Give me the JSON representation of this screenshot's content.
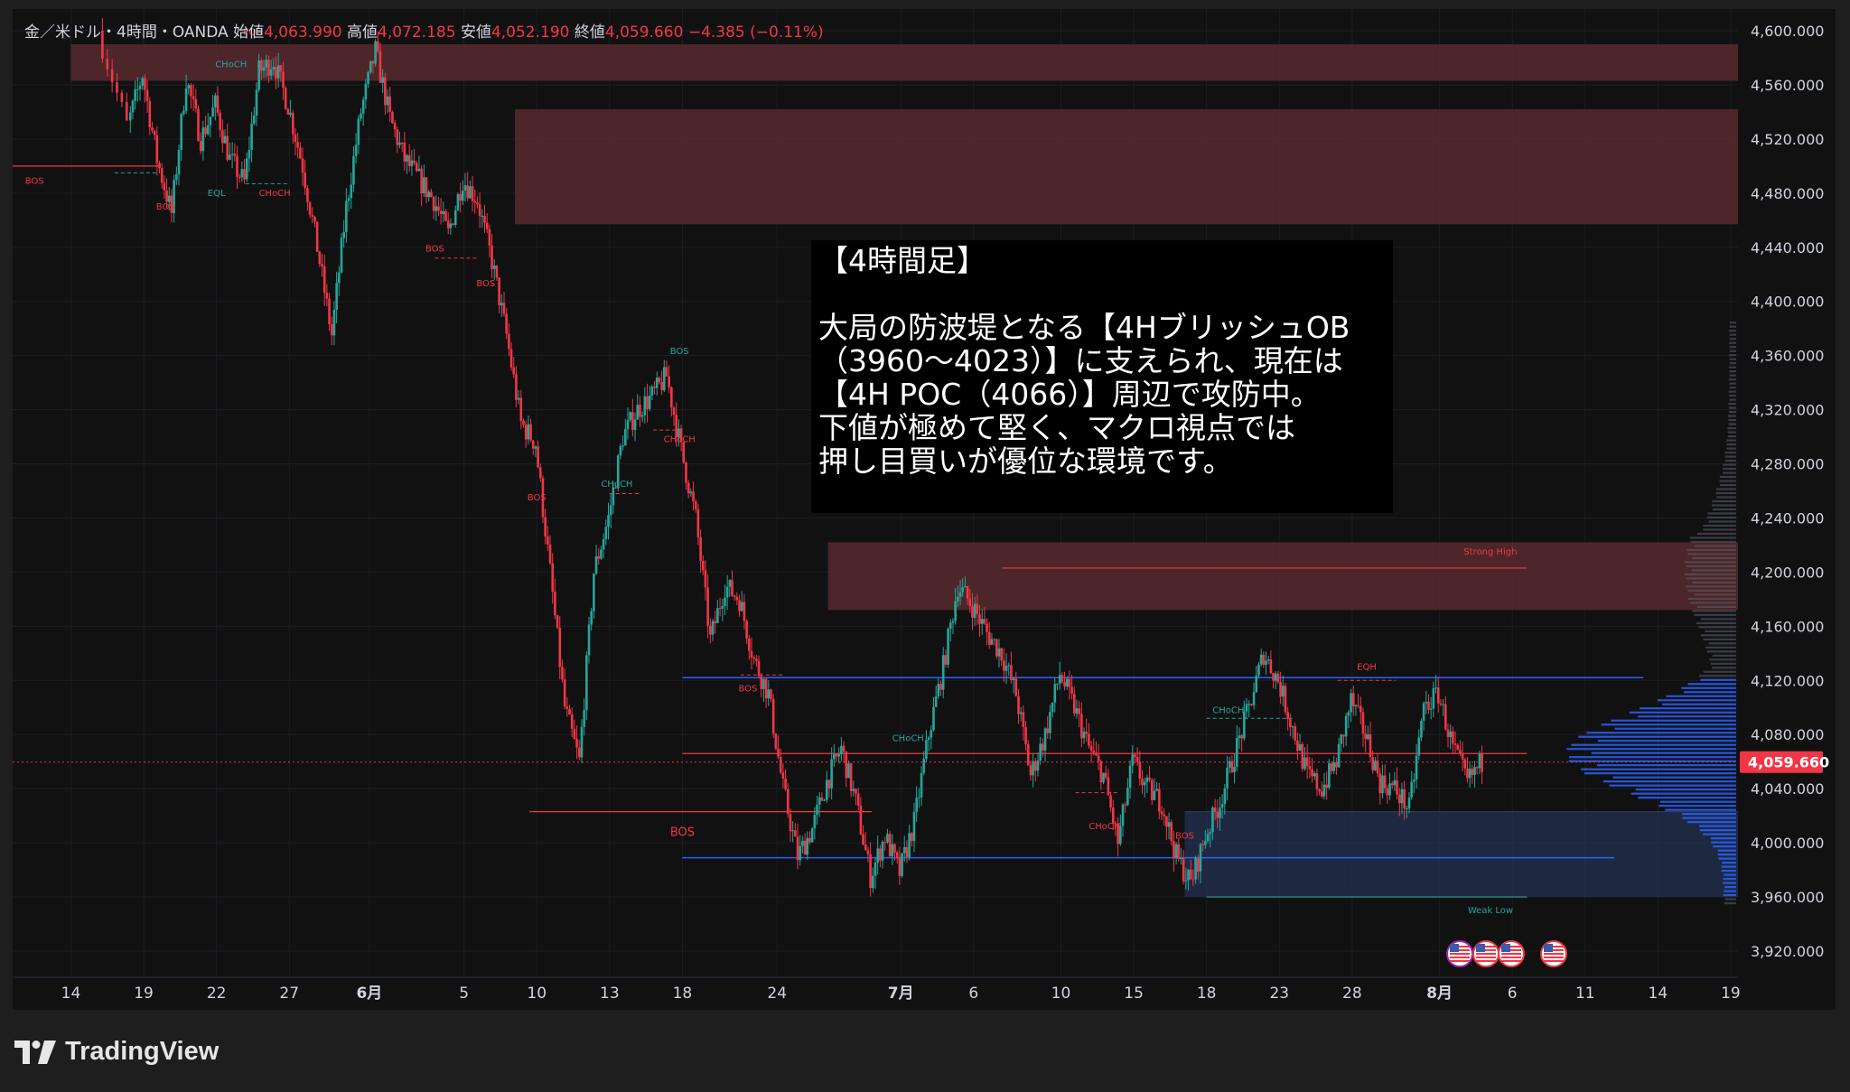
{
  "header": {
    "symbol": "金／米ドル・4時間・OANDA",
    "open_label": "始値",
    "open": "4,063.990",
    "high_label": "高値",
    "high": "4,072.185",
    "low_label": "安値",
    "low": "4,052.190",
    "close_label": "終値",
    "close": "4,059.660",
    "change": "−4.385 (−0.11%)"
  },
  "annotation": {
    "title": "【4時間足】",
    "lines": [
      "大局の防波堤となる【4HブリッシュOB",
      "（3960〜4023）】に支えられ、現在は",
      "【4H POC（4066）】周辺で攻防中。",
      "下値が極めて堅く、マクロ視点では",
      "押し目買いが優位な環境です。"
    ]
  },
  "brand": {
    "name": "TradingView",
    "icon": "tradingview-logo-icon"
  },
  "colors": {
    "up": "#26a69a",
    "down": "#f23645",
    "supply_zone": "#5b2c2f",
    "demand_zone": "#22304d",
    "volume_profile": "#2962ff",
    "blue_line": "#2962ff",
    "price_badge": "#f23645"
  },
  "chart_data": {
    "type": "candlestick",
    "symbol": "XAU/USD",
    "timeframe": "4H",
    "ylim": [
      3900,
      4610
    ],
    "y_ticks": [
      "4,600.000",
      "4,560.000",
      "4,520.000",
      "4,480.000",
      "4,440.000",
      "4,400.000",
      "4,360.000",
      "4,320.000",
      "4,280.000",
      "4,240.000",
      "4,200.000",
      "4,160.000",
      "4,120.000",
      "4,080.000",
      "4,040.000",
      "4,000.000",
      "3,960.000",
      "3,920.000"
    ],
    "current_price": 4059.66,
    "current_price_label": "4,059.660",
    "x_labels": [
      {
        "label": "14",
        "day": -4
      },
      {
        "label": "19",
        "day": 1
      },
      {
        "label": "22",
        "day": 6
      },
      {
        "label": "27",
        "day": 11
      },
      {
        "label": "6月",
        "day": 16.5
      },
      {
        "label": "5",
        "day": 23
      },
      {
        "label": "10",
        "day": 28
      },
      {
        "label": "13",
        "day": 33
      },
      {
        "label": "18",
        "day": 38
      },
      {
        "label": "24",
        "day": 44.5
      },
      {
        "label": "7月",
        "day": 53
      },
      {
        "label": "6",
        "day": 58
      },
      {
        "label": "10",
        "day": 64
      },
      {
        "label": "15",
        "day": 69
      },
      {
        "label": "18",
        "day": 74
      },
      {
        "label": "23",
        "day": 79
      },
      {
        "label": "28",
        "day": 84
      },
      {
        "label": "8月",
        "day": 90
      },
      {
        "label": "6",
        "day": 95
      },
      {
        "label": "11",
        "day": 100
      },
      {
        "label": "14",
        "day": 105
      },
      {
        "label": "19",
        "day": 110
      }
    ],
    "x_range_days": [
      -8,
      110.5
    ],
    "path": [
      [
        -2,
        4600
      ],
      [
        0,
        4530
      ],
      [
        1,
        4568
      ],
      [
        2,
        4505
      ],
      [
        3,
        4465
      ],
      [
        4,
        4565
      ],
      [
        5,
        4520
      ],
      [
        6,
        4545
      ],
      [
        7,
        4505
      ],
      [
        8,
        4488
      ],
      [
        9,
        4570
      ],
      [
        10,
        4578
      ],
      [
        11,
        4545
      ],
      [
        12,
        4500
      ],
      [
        13,
        4440
      ],
      [
        14,
        4375
      ],
      [
        15,
        4470
      ],
      [
        16,
        4540
      ],
      [
        17,
        4585
      ],
      [
        18,
        4535
      ],
      [
        19,
        4505
      ],
      [
        20,
        4490
      ],
      [
        21,
        4475
      ],
      [
        22,
        4450
      ],
      [
        23,
        4490
      ],
      [
        24,
        4475
      ],
      [
        25,
        4430
      ],
      [
        26,
        4375
      ],
      [
        27,
        4310
      ],
      [
        28,
        4295
      ],
      [
        29,
        4200
      ],
      [
        30,
        4100
      ],
      [
        31,
        4060
      ],
      [
        32,
        4200
      ],
      [
        33,
        4240
      ],
      [
        34,
        4300
      ],
      [
        35,
        4320
      ],
      [
        36,
        4330
      ],
      [
        37,
        4345
      ],
      [
        38,
        4290
      ],
      [
        39,
        4240
      ],
      [
        40,
        4150
      ],
      [
        41,
        4190
      ],
      [
        42,
        4180
      ],
      [
        43,
        4135
      ],
      [
        44,
        4110
      ],
      [
        45,
        4040
      ],
      [
        46,
        3990
      ],
      [
        47,
        4010
      ],
      [
        48,
        4045
      ],
      [
        49,
        4070
      ],
      [
        50,
        4030
      ],
      [
        51,
        3975
      ],
      [
        52,
        4005
      ],
      [
        53,
        3978
      ],
      [
        54,
        4015
      ],
      [
        55,
        4080
      ],
      [
        56,
        4130
      ],
      [
        57,
        4190
      ],
      [
        58,
        4175
      ],
      [
        59,
        4155
      ],
      [
        60,
        4140
      ],
      [
        61,
        4110
      ],
      [
        62,
        4050
      ],
      [
        63,
        4080
      ],
      [
        64,
        4125
      ],
      [
        65,
        4100
      ],
      [
        66,
        4070
      ],
      [
        67,
        4050
      ],
      [
        68,
        4000
      ],
      [
        69,
        4060
      ],
      [
        70,
        4040
      ],
      [
        71,
        4030
      ],
      [
        72,
        3990
      ],
      [
        73,
        3970
      ],
      [
        74,
        4005
      ],
      [
        75,
        4030
      ],
      [
        76,
        4065
      ],
      [
        77,
        4100
      ],
      [
        78,
        4140
      ],
      [
        79,
        4120
      ],
      [
        80,
        4085
      ],
      [
        81,
        4050
      ],
      [
        82,
        4040
      ],
      [
        83,
        4060
      ],
      [
        84,
        4105
      ],
      [
        85,
        4080
      ],
      [
        86,
        4045
      ],
      [
        87,
        4040
      ],
      [
        88,
        4025
      ],
      [
        89,
        4100
      ],
      [
        90,
        4110
      ],
      [
        91,
        4070
      ],
      [
        92,
        4045
      ],
      [
        93,
        4060
      ]
    ],
    "zones": [
      {
        "kind": "supply",
        "y1": 4563,
        "y2": 4590,
        "d1": -4,
        "d2": 110.5
      },
      {
        "kind": "supply",
        "y1": 4457,
        "y2": 4542,
        "d1": 26.5,
        "d2": 110.5
      },
      {
        "kind": "supply",
        "y1": 4172,
        "y2": 4222,
        "d1": 48,
        "d2": 110.5
      },
      {
        "kind": "demand",
        "y1": 3960,
        "y2": 4023,
        "d1": 72.5,
        "d2": 110.5
      }
    ],
    "levels": [
      {
        "kind": "blue",
        "y": 4122,
        "d1": 38,
        "d2": 104
      },
      {
        "kind": "blue",
        "y": 3989,
        "d1": 38,
        "d2": 102
      },
      {
        "kind": "red",
        "y": 4066,
        "d1": 38,
        "d2": 96
      },
      {
        "kind": "red",
        "y": 4203,
        "d1": 60,
        "d2": 96
      },
      {
        "kind": "red",
        "y": 4500,
        "d1": -8,
        "d2": 2
      },
      {
        "kind": "red",
        "y": 4023,
        "d1": 27.5,
        "d2": 51
      },
      {
        "kind": "teal",
        "y": 3960,
        "d1": 74,
        "d2": 96
      }
    ],
    "labels": [
      {
        "text": "BOS",
        "d": -6.5,
        "y": 4487,
        "color": "red"
      },
      {
        "text": "BOS",
        "d": 2.5,
        "y": 4468,
        "color": "red"
      },
      {
        "text": "CHoCH",
        "d": 7,
        "y": 4573,
        "color": "teal"
      },
      {
        "text": "EQH",
        "d": 8.5,
        "y": 4597,
        "color": "red"
      },
      {
        "text": "EQL",
        "d": 6,
        "y": 4478,
        "color": "teal"
      },
      {
        "text": "CHoCH",
        "d": 10,
        "y": 4478,
        "color": "red"
      },
      {
        "text": "BOS",
        "d": 21,
        "y": 4437,
        "color": "red"
      },
      {
        "text": "BOS",
        "d": 24.5,
        "y": 4411,
        "color": "red"
      },
      {
        "text": "BOS",
        "d": 28,
        "y": 4253,
        "color": "red"
      },
      {
        "text": "CHoCH",
        "d": 33.5,
        "y": 4263,
        "color": "teal"
      },
      {
        "text": "BOS",
        "d": 37.8,
        "y": 4361,
        "color": "teal"
      },
      {
        "text": "CHoCH",
        "d": 37.8,
        "y": 4296,
        "color": "red"
      },
      {
        "text": "BOS",
        "d": 42.5,
        "y": 4112,
        "color": "red"
      },
      {
        "text": "BOS",
        "d": 38,
        "y": 4005,
        "color": "red",
        "size": 13
      },
      {
        "text": "CHoCH",
        "d": 53.5,
        "y": 4075,
        "color": "teal"
      },
      {
        "text": "CHoCH",
        "d": 67,
        "y": 4010,
        "color": "red"
      },
      {
        "text": "BOS",
        "d": 72.5,
        "y": 4003,
        "color": "red"
      },
      {
        "text": "CHoCH",
        "d": 75.5,
        "y": 4096,
        "color": "teal"
      },
      {
        "text": "EQH",
        "d": 85,
        "y": 4128,
        "color": "red"
      },
      {
        "text": "Strong High",
        "d": 93.5,
        "y": 4213,
        "color": "red"
      },
      {
        "text": "Weak Low",
        "d": 93.5,
        "y": 3948,
        "color": "teal"
      }
    ],
    "events_icon": "us-flag-icon"
  }
}
